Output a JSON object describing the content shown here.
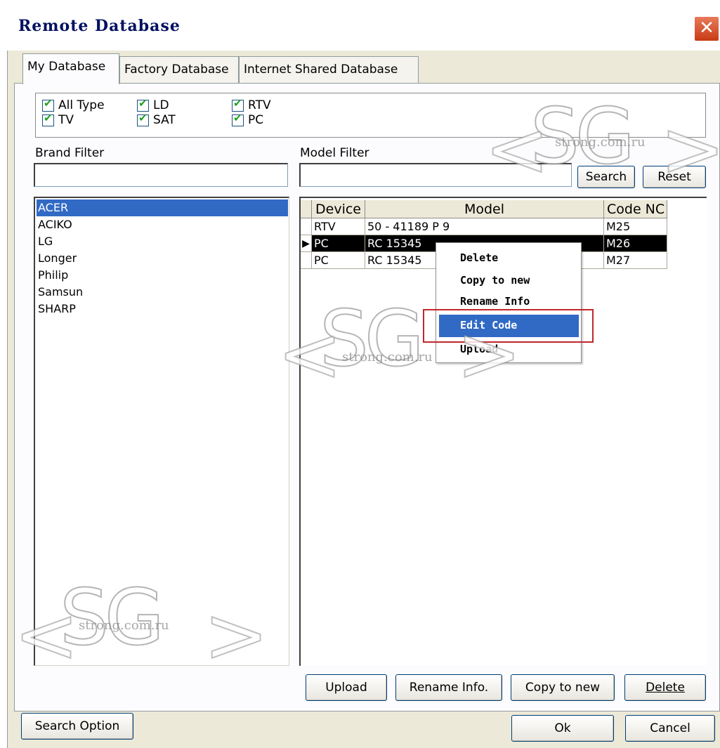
{
  "window": {
    "title": "Remote Database",
    "close_glyph": "✕"
  },
  "tabs": [
    "My Database",
    "Factory Database",
    "Internet Shared Database"
  ],
  "type_filters": [
    "All Type",
    "LD",
    "RTV",
    "TV",
    "SAT",
    "PC"
  ],
  "brand_filter": {
    "label": "Brand Filter",
    "value": ""
  },
  "model_filter": {
    "label": "Model Filter",
    "value": ""
  },
  "buttons": {
    "search": "Search",
    "reset": "Reset",
    "upload": "Upload",
    "rename_info": "Rename Info.",
    "copy_to_new": "Copy to new",
    "delete": "Delete",
    "search_option": "Search Option",
    "ok": "Ok",
    "cancel": "Cancel"
  },
  "brands": [
    "ACER",
    "ACIKO",
    "LG",
    "Longer",
    "Philip",
    "Samsun",
    "SHARP"
  ],
  "selected_brand": "ACER",
  "table": {
    "headers": [
      "Device",
      "Model",
      "Code NC"
    ],
    "rows": [
      {
        "device": "RTV",
        "model": "50 - 41189 P 9",
        "code": "M25"
      },
      {
        "device": "PC",
        "model": "RC 15345",
        "code": "M26"
      },
      {
        "device": "PC",
        "model": "RC 15345",
        "code": "M27"
      }
    ],
    "selected_row": 1
  },
  "context_menu": {
    "items": [
      "Delete",
      "Copy to new",
      "Rename Info",
      "Edit Code",
      "Upload"
    ],
    "highlighted": "Edit Code"
  },
  "watermark": {
    "text": "strong.com.ru",
    "logo": "SG"
  },
  "colors": {
    "selection": "#316ac5",
    "highlight_box": "#c0272d",
    "dialog_bg": "#ece9d8"
  }
}
